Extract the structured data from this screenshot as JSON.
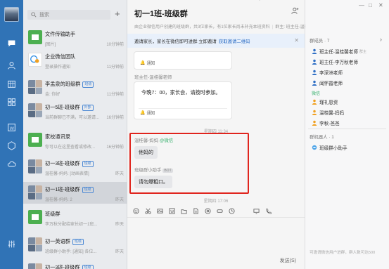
{
  "window": {
    "minimize": "—",
    "maximize": "□",
    "close": "✕"
  },
  "search": {
    "placeholder": "搜索",
    "plus": "+"
  },
  "conversations": [
    {
      "name": "文件传输助手",
      "preview": "[图片]",
      "time": "10分钟前",
      "tag": "",
      "avatar_color": "#4caf50"
    },
    {
      "name": "企业微信团队",
      "preview": "登录操作通知",
      "time": "11分钟前",
      "tag": "",
      "avatar_color": "#ffffff"
    },
    {
      "name": "李孟泉的班级群",
      "preview": "金: 你好",
      "time": "11分钟前",
      "tag": "班级",
      "avatar_color": "grid"
    },
    {
      "name": "初一5班-班级群",
      "preview": "当前群聊已不满，可以邀请...",
      "time": "16分钟前",
      "tag": "外部",
      "avatar_color": "grid"
    },
    {
      "name": "家校通讯录",
      "preview": "你可以在这里查看或修改...",
      "time": "16分钟前",
      "tag": "",
      "avatar_color": "#4caf50"
    },
    {
      "name": "初一3班-班级群",
      "preview": "温桂馨-妈妈: [动画表情]",
      "time": "昨天",
      "tag": "班级",
      "avatar_color": "grid"
    },
    {
      "name": "初一1班-班级群",
      "preview": "温桂馨-妈妈: 2",
      "time": "昨天",
      "tag": "班级",
      "avatar_color": "grid"
    },
    {
      "name": "班级群",
      "preview": "李万秋分配给家长初一1班...",
      "time": "昨天",
      "tag": "",
      "avatar_color": "#4caf50"
    },
    {
      "name": "初一英语群",
      "preview": "班级群小助手: [通知] 各位...",
      "time": "昨天",
      "tag": "班级",
      "avatar_color": "grid"
    },
    {
      "name": "初一3班-班级群",
      "preview": "",
      "time": "",
      "tag": "班级",
      "avatar_color": "grid"
    }
  ],
  "chat": {
    "title": "初一1班-班级群",
    "subtitle_left": "由企业微信用户创建的班级群，共3位家长，有1位家长尚未补充本班资料",
    "subtitle_right": "群主: 班主任-温桂馨老师",
    "invite_text": "邀请家长，家长在微信即可进群 立即邀请",
    "invite_link": "获取邀请二维码",
    "notice_label": "通知",
    "sender_1": "班主任-温桂馨老师",
    "message_1": "今晚7：00，家长会，请按时参加。",
    "time_1": "星期四 11:34",
    "sender_2": "温桂馨-妈妈",
    "sender_2_tag": "@微信",
    "message_2": "他妈的",
    "sender_3": "班级群小助手",
    "sender_3_tag": "BOT",
    "message_3": "请勿爆粗口。",
    "time_2": "星期四 17:06",
    "send_label": "发送(S)"
  },
  "members": {
    "header": "群成员 · 7",
    "list": [
      {
        "name": "班主任-温桂馨老师",
        "suffix": "群主"
      },
      {
        "name": "班主任-李万秋老师",
        "suffix": ""
      },
      {
        "name": "李深洲老师",
        "suffix": ""
      },
      {
        "name": "闻怀霞老师",
        "suffix": ""
      }
    ],
    "wechat_section": "微信",
    "wechat_list": [
      {
        "name": "瑾礼恩资"
      },
      {
        "name": "温桂馨-妈妈"
      },
      {
        "name": "李秋-爸爸"
      }
    ],
    "robot_header": "群机器人 · 1",
    "robot": "班级群小助手",
    "footer": "可邀请微信用户进群，群人数可达500"
  },
  "colors": {
    "accent": "#3073b6",
    "highlight": "#e0241d",
    "link": "#2f6fc5",
    "wechat": "#3cb371"
  }
}
